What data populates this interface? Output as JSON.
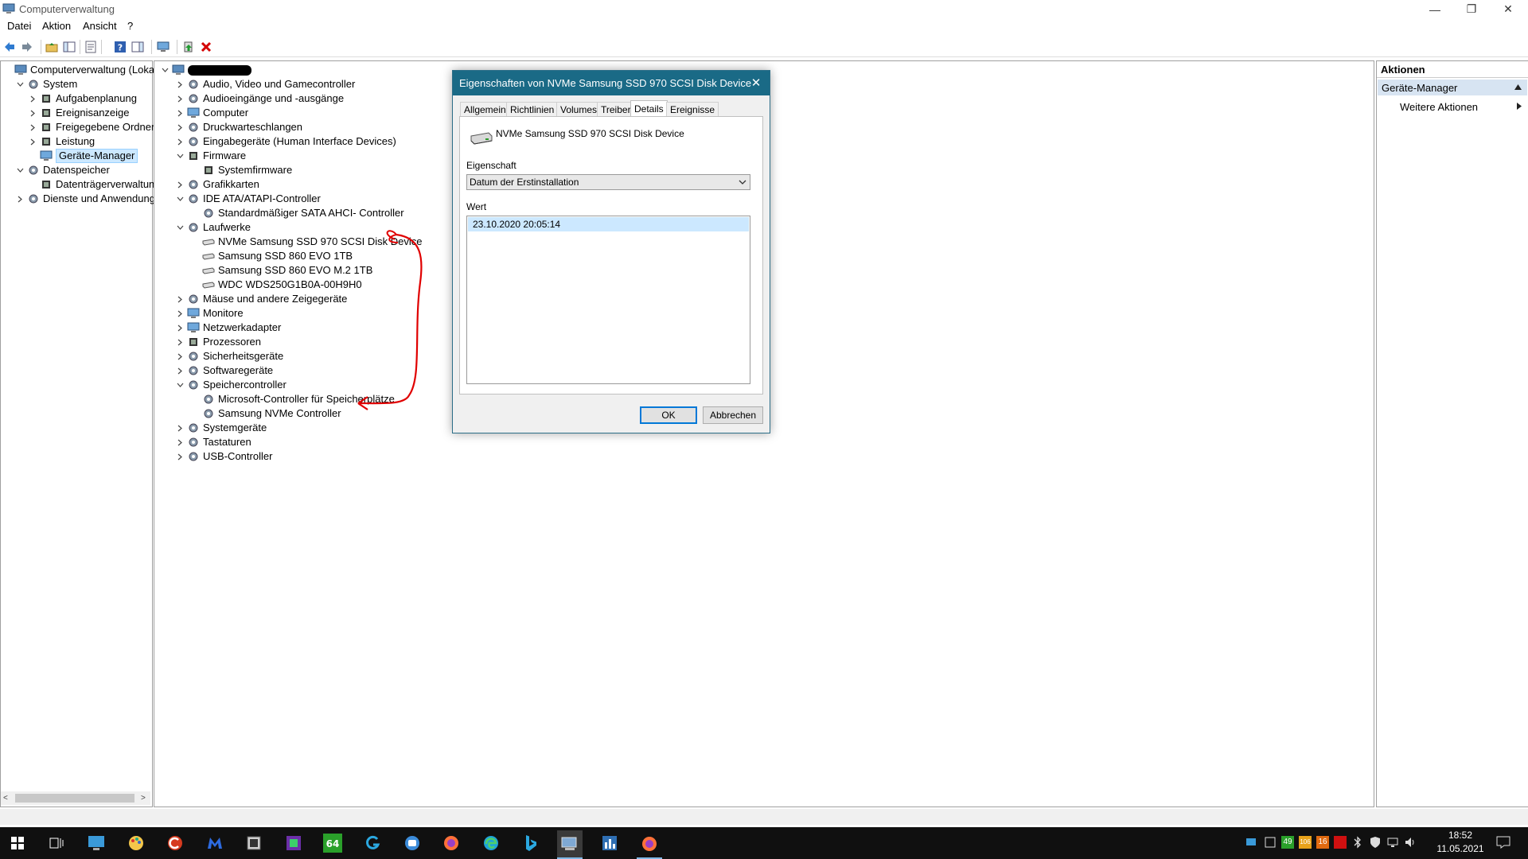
{
  "window": {
    "title": "Computerverwaltung",
    "menu": [
      "Datei",
      "Aktion",
      "Ansicht",
      "?"
    ]
  },
  "left_tree": [
    {
      "label": "Computerverwaltung (Lokal)",
      "level": 0,
      "chevron": ""
    },
    {
      "label": "System",
      "level": 1,
      "chevron": "open"
    },
    {
      "label": "Aufgabenplanung",
      "level": 2,
      "chevron": "closed"
    },
    {
      "label": "Ereignisanzeige",
      "level": 2,
      "chevron": "closed"
    },
    {
      "label": "Freigegebene Ordner",
      "level": 2,
      "chevron": "closed"
    },
    {
      "label": "Leistung",
      "level": 2,
      "chevron": "closed"
    },
    {
      "label": "Geräte-Manager",
      "level": 2,
      "chevron": "",
      "selected": true
    },
    {
      "label": "Datenspeicher",
      "level": 1,
      "chevron": "open"
    },
    {
      "label": "Datenträgerverwaltung",
      "level": 2,
      "chevron": ""
    },
    {
      "label": "Dienste und Anwendungen",
      "level": 1,
      "chevron": "closed"
    }
  ],
  "device_tree": [
    {
      "label": "",
      "level": 0,
      "chevron": "open",
      "redacted": true
    },
    {
      "label": "Audio, Video und Gamecontroller",
      "level": 1,
      "chevron": "closed"
    },
    {
      "label": "Audioeingänge und -ausgänge",
      "level": 1,
      "chevron": "closed"
    },
    {
      "label": "Computer",
      "level": 1,
      "chevron": "closed"
    },
    {
      "label": "Druckwarteschlangen",
      "level": 1,
      "chevron": "closed"
    },
    {
      "label": "Eingabegeräte (Human Interface Devices)",
      "level": 1,
      "chevron": "closed"
    },
    {
      "label": "Firmware",
      "level": 1,
      "chevron": "open"
    },
    {
      "label": "Systemfirmware",
      "level": 2,
      "chevron": ""
    },
    {
      "label": "Grafikkarten",
      "level": 1,
      "chevron": "closed"
    },
    {
      "label": "IDE ATA/ATAPI-Controller",
      "level": 1,
      "chevron": "open"
    },
    {
      "label": "Standardmäßiger SATA AHCI- Controller",
      "level": 2,
      "chevron": ""
    },
    {
      "label": "Laufwerke",
      "level": 1,
      "chevron": "open"
    },
    {
      "label": "NVMe Samsung SSD 970 SCSI Disk Device",
      "level": 2,
      "chevron": ""
    },
    {
      "label": "Samsung SSD 860 EVO 1TB",
      "level": 2,
      "chevron": ""
    },
    {
      "label": "Samsung SSD 860 EVO M.2 1TB",
      "level": 2,
      "chevron": ""
    },
    {
      "label": "WDC WDS250G1B0A-00H9H0",
      "level": 2,
      "chevron": ""
    },
    {
      "label": "Mäuse und andere Zeigegeräte",
      "level": 1,
      "chevron": "closed"
    },
    {
      "label": "Monitore",
      "level": 1,
      "chevron": "closed"
    },
    {
      "label": "Netzwerkadapter",
      "level": 1,
      "chevron": "closed"
    },
    {
      "label": "Prozessoren",
      "level": 1,
      "chevron": "closed"
    },
    {
      "label": "Sicherheitsgeräte",
      "level": 1,
      "chevron": "closed"
    },
    {
      "label": "Softwaregeräte",
      "level": 1,
      "chevron": "closed"
    },
    {
      "label": "Speichercontroller",
      "level": 1,
      "chevron": "open"
    },
    {
      "label": "Microsoft-Controller für Speicherplätze",
      "level": 2,
      "chevron": ""
    },
    {
      "label": "Samsung NVMe Controller",
      "level": 2,
      "chevron": ""
    },
    {
      "label": "Systemgeräte",
      "level": 1,
      "chevron": "closed"
    },
    {
      "label": "Tastaturen",
      "level": 1,
      "chevron": "closed"
    },
    {
      "label": "USB-Controller",
      "level": 1,
      "chevron": "closed"
    }
  ],
  "actions": {
    "header": "Aktionen",
    "section": "Geräte-Manager",
    "item": "Weitere Aktionen"
  },
  "dialog": {
    "title": "Eigenschaften von NVMe Samsung SSD 970 SCSI Disk Device",
    "tabs": [
      "Allgemein",
      "Richtlinien",
      "Volumes",
      "Treiber",
      "Details",
      "Ereignisse"
    ],
    "active_tab": "Details",
    "device_name": "NVMe Samsung SSD 970 SCSI Disk Device",
    "property_label": "Eigenschaft",
    "property_value": "Datum der Erstinstallation",
    "value_label": "Wert",
    "value": "23.10.2020 20:05:14",
    "ok": "OK",
    "cancel": "Abbrechen"
  },
  "tray": {
    "time": "18:52",
    "date": "11.05.2021",
    "badges": [
      "49",
      "106",
      "16"
    ]
  },
  "colors": {
    "dialog_title_bg": "#1a6a86",
    "annotation": "#e00000",
    "selection_bg": "#cce8ff",
    "taskbar_bg": "#101010"
  }
}
